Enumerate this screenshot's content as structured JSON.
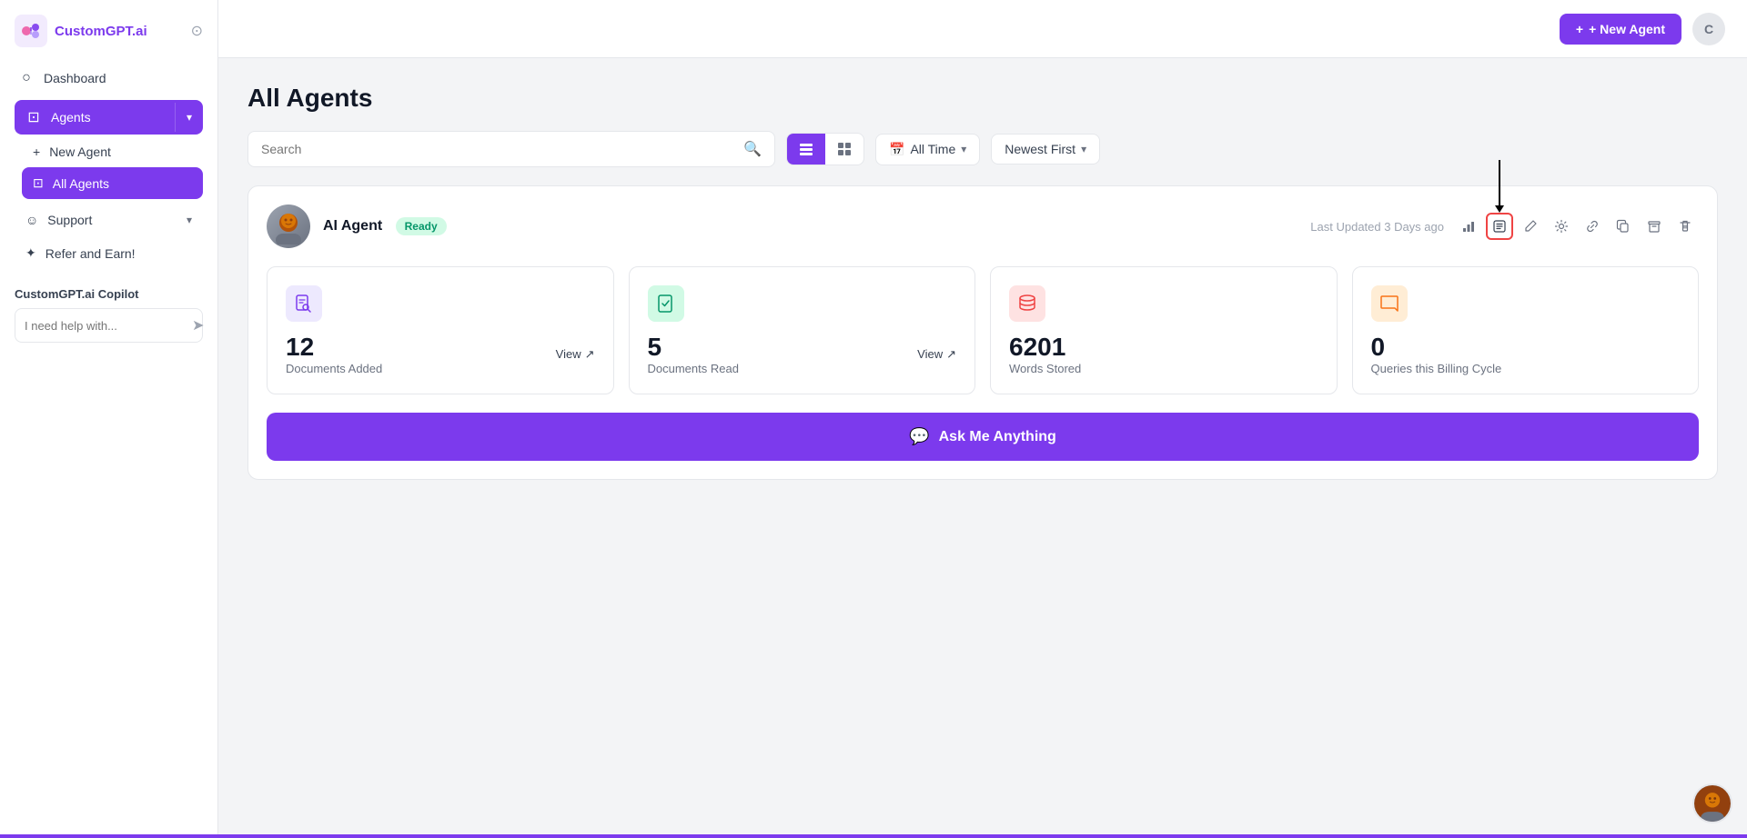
{
  "logo": {
    "text": "CustomGPT.ai"
  },
  "sidebar": {
    "nav": [
      {
        "id": "dashboard",
        "label": "Dashboard",
        "icon": "○"
      },
      {
        "id": "agents",
        "label": "Agents",
        "icon": "⊡",
        "active": true
      },
      {
        "id": "new-agent",
        "label": "New Agent",
        "icon": "+"
      },
      {
        "id": "all-agents",
        "label": "All Agents",
        "icon": "⊡",
        "active": true
      }
    ],
    "support_label": "Support",
    "refer_label": "Refer and Earn!",
    "copilot_title": "CustomGPT.ai Copilot",
    "copilot_placeholder": "I need help with..."
  },
  "topbar": {
    "new_agent_label": "+ New Agent",
    "avatar_letter": "C"
  },
  "page": {
    "title": "All Agents"
  },
  "toolbar": {
    "search_placeholder": "Search",
    "view_list_active": true,
    "filter_time": "All Time",
    "filter_sort": "Newest First"
  },
  "agent": {
    "name": "AI Agent",
    "status": "Ready",
    "last_updated": "Last Updated 3 Days ago",
    "stats": [
      {
        "id": "docs-added",
        "number": "12",
        "label": "Documents Added",
        "has_view": true,
        "view_label": "View",
        "icon_color": "purple"
      },
      {
        "id": "docs-read",
        "number": "5",
        "label": "Documents Read",
        "has_view": true,
        "view_label": "View",
        "icon_color": "teal"
      },
      {
        "id": "words-stored",
        "number": "6201",
        "label": "Words Stored",
        "has_view": false,
        "icon_color": "red"
      },
      {
        "id": "queries",
        "number": "0",
        "label": "Queries this Billing Cycle",
        "has_view": false,
        "icon_color": "orange"
      }
    ],
    "ask_label": "Ask Me Anything"
  }
}
